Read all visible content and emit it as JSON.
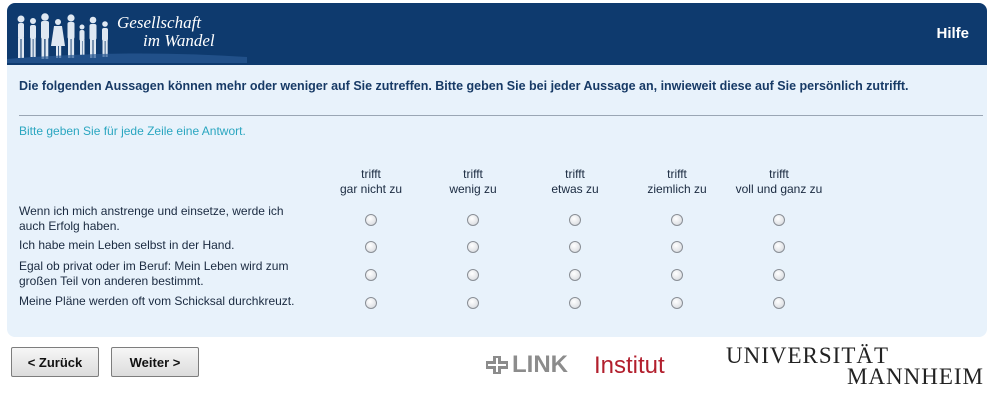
{
  "header": {
    "brand_line1": "Gesellschaft",
    "brand_line2": "im Wandel",
    "help_label": "Hilfe"
  },
  "question": {
    "intro": "Die folgenden Aussagen können mehr oder weniger auf Sie zutreffen. Bitte geben Sie bei jeder Aussage an, inwieweit diese auf Sie persönlich zutrifft.",
    "hint": "Bitte geben Sie für jede Zeile eine Antwort."
  },
  "scale": [
    {
      "line1": "trifft",
      "line2": "gar nicht zu"
    },
    {
      "line1": "trifft",
      "line2": "wenig zu"
    },
    {
      "line1": "trifft",
      "line2": "etwas zu"
    },
    {
      "line1": "trifft",
      "line2": "ziemlich zu"
    },
    {
      "line1": "trifft",
      "line2": "voll und ganz zu"
    }
  ],
  "items": [
    {
      "line1": "Wenn ich mich anstrenge und einsetze, werde ich",
      "line2": "auch Erfolg haben."
    },
    {
      "line1": "Ich habe mein Leben selbst in der Hand.",
      "line2": ""
    },
    {
      "line1": "Egal ob privat oder im Beruf: Mein Leben wird zum",
      "line2": "großen Teil von anderen bestimmt."
    },
    {
      "line1": "Meine Pläne werden oft vom Schicksal durchkreuzt.",
      "line2": ""
    }
  ],
  "nav": {
    "back_label": "< Zurück",
    "next_label": "Weiter >"
  },
  "logos": {
    "link_word": "LINK",
    "link_word2": "Institut",
    "uni_line1": "UNIVERSITÄT",
    "uni_line2": "MANNHEIM"
  },
  "colors": {
    "header_bg": "#0e3a6e",
    "panel_bg": "#e8f2fb",
    "intro_text": "#173a66",
    "hint_text": "#2aa6c0",
    "link_red": "#b21f2d"
  }
}
